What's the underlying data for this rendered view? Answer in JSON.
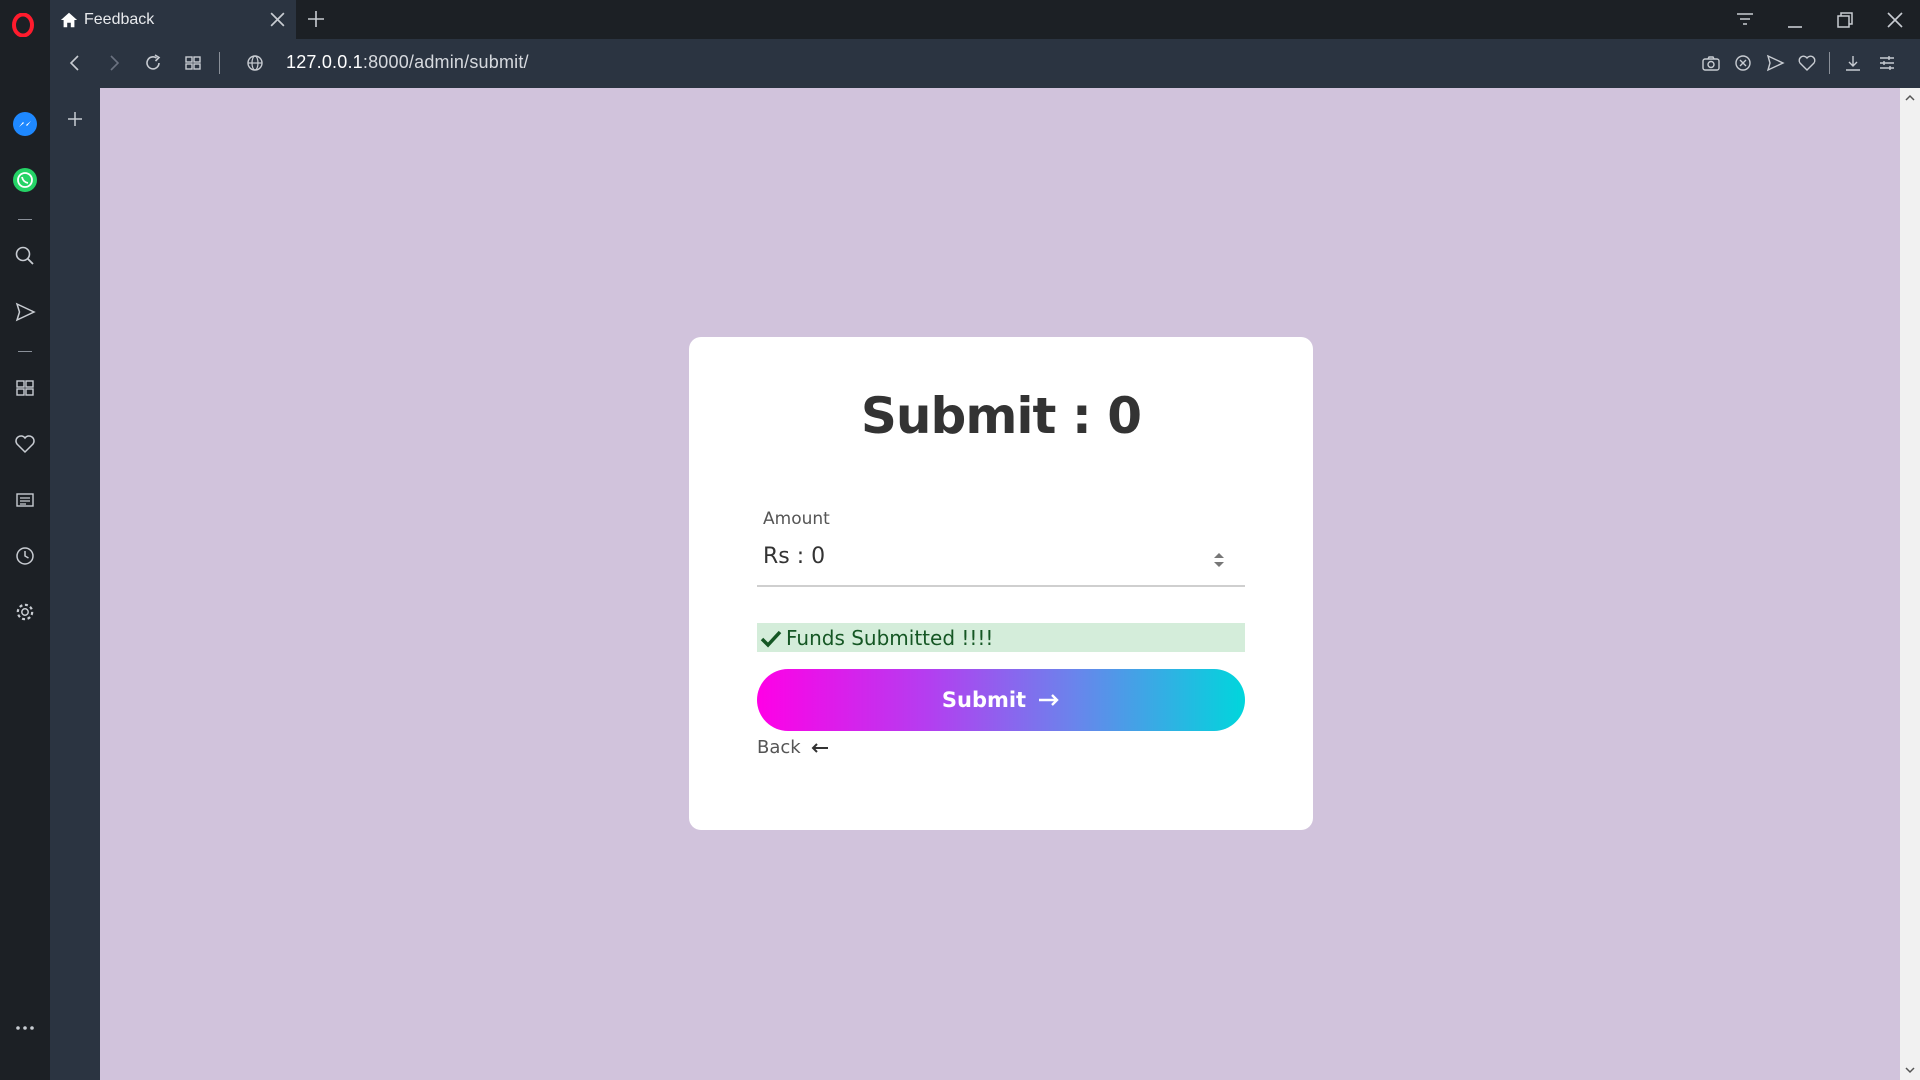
{
  "browser": {
    "tab_title": "Feedback",
    "url_host": "127.0.0.1",
    "url_rest": ":8000/admin/submit/"
  },
  "page": {
    "title": "Submit : 0",
    "amount_label": "Amount",
    "amount_value": "Rs : 0",
    "alert_message": "Funds Submitted !!!!",
    "submit_label": "Submit",
    "back_label": "Back"
  },
  "colors": {
    "background": "#d1c3dc",
    "alert_bg": "#d4edda",
    "gradient_start": "#ff00e6",
    "gradient_end": "#00d6dc"
  }
}
